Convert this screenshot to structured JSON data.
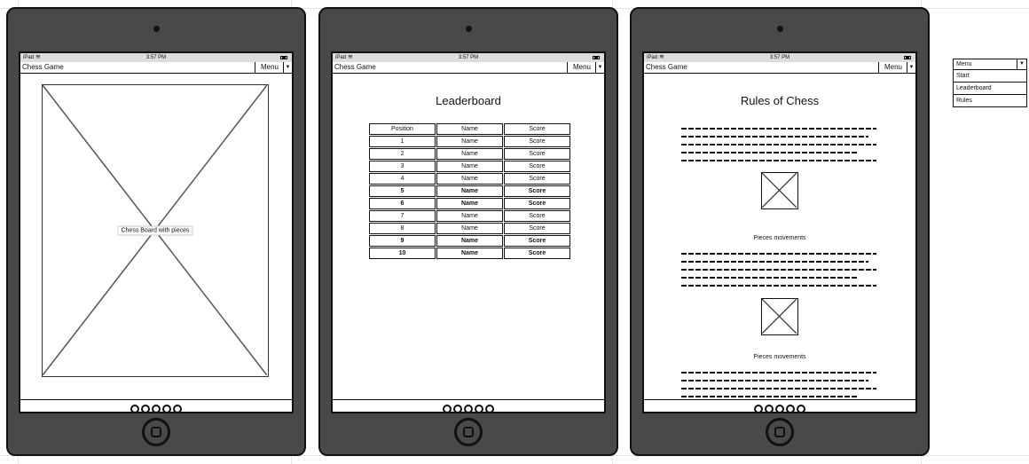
{
  "status_bar": {
    "carrier": "iPad",
    "time": "3:57 PM"
  },
  "app": {
    "title": "Chess Game",
    "menu_label": "Menu",
    "menu_arrow": "▼"
  },
  "screen1": {
    "board_placeholder": "Chess Board with pieces"
  },
  "screen2": {
    "title": "Leaderboard",
    "headers": [
      "Position",
      "Name",
      "Score"
    ],
    "rows": [
      [
        "1",
        "Name",
        "Score"
      ],
      [
        "2",
        "Name",
        "Score"
      ],
      [
        "3",
        "Name",
        "Score"
      ],
      [
        "4",
        "Name",
        "Score"
      ],
      [
        "5",
        "Name",
        "Score"
      ],
      [
        "6",
        "Name",
        "Score"
      ],
      [
        "7",
        "Name",
        "Score"
      ],
      [
        "8",
        "Name",
        "Score"
      ],
      [
        "9",
        "Name",
        "Score"
      ],
      [
        "10",
        "Name",
        "Score"
      ]
    ],
    "bold_rows": [
      4,
      5,
      8,
      9
    ]
  },
  "screen3": {
    "title": "Rules of Chess",
    "caption_1": "Pieces movements",
    "caption_2": "Pieces movements"
  },
  "footer": {
    "icons": [
      "github-icon",
      "github-icon",
      "github-icon",
      "github-icon",
      "github-icon"
    ]
  },
  "dropdown": {
    "label": "Menu",
    "items": [
      "Start",
      "Leaderboard",
      "Rules"
    ]
  }
}
